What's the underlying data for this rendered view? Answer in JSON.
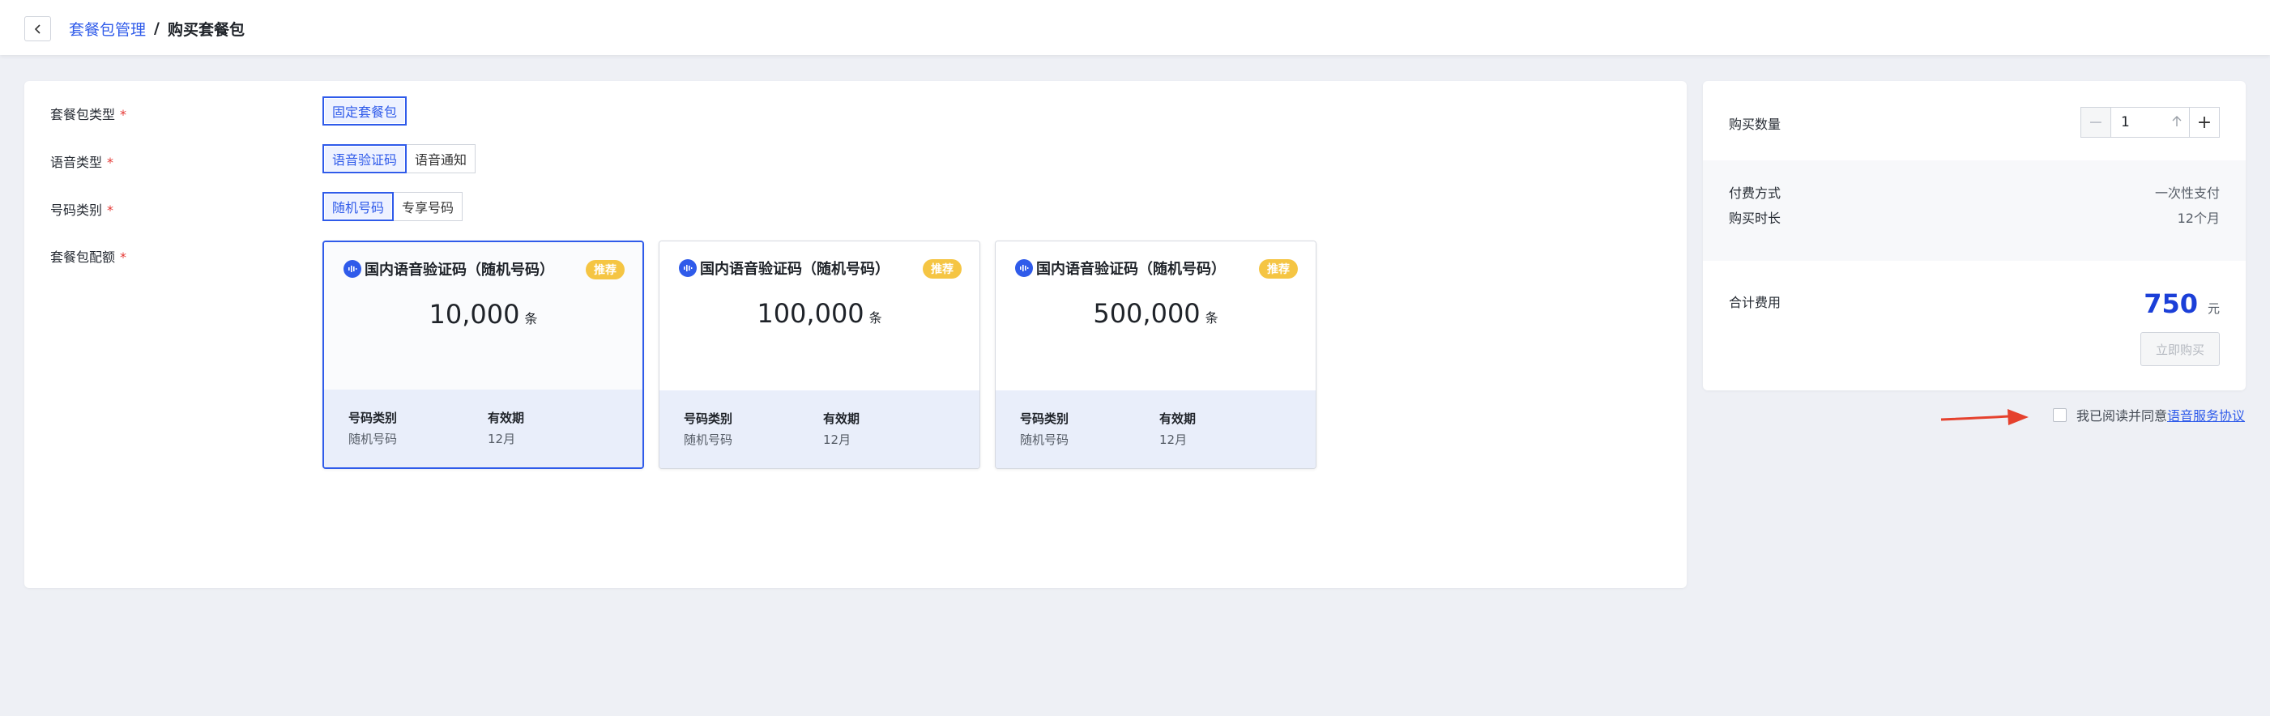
{
  "header": {
    "back_icon": "chevron-left-icon",
    "breadcrumb_parent": "套餐包管理",
    "breadcrumb_sep": "/",
    "breadcrumb_current": "购买套餐包"
  },
  "form": {
    "package_type": {
      "label": "套餐包类型",
      "required": "*",
      "options": [
        "固定套餐包"
      ],
      "selected": "固定套餐包"
    },
    "voice_type": {
      "label": "语音类型",
      "required": "*",
      "options": [
        "语音验证码",
        "语音通知"
      ],
      "selected": "语音验证码"
    },
    "number_type": {
      "label": "号码类别",
      "required": "*",
      "options": [
        "随机号码",
        "专享号码"
      ],
      "selected": "随机号码"
    },
    "quota": {
      "label": "套餐包配额",
      "required": "*"
    }
  },
  "cards": [
    {
      "title": "国内语音验证码（随机号码）",
      "badge": "推荐",
      "amount": "10,000",
      "unit": "条",
      "key1": "号码类别",
      "val1": "随机号码",
      "key2": "有效期",
      "val2": "12月",
      "selected": true
    },
    {
      "title": "国内语音验证码（随机号码）",
      "badge": "推荐",
      "amount": "100,000",
      "unit": "条",
      "key1": "号码类别",
      "val1": "随机号码",
      "key2": "有效期",
      "val2": "12月",
      "selected": false
    },
    {
      "title": "国内语音验证码（随机号码）",
      "badge": "推荐",
      "amount": "500,000",
      "unit": "条",
      "key1": "号码类别",
      "val1": "随机号码",
      "key2": "有效期",
      "val2": "12月",
      "selected": false
    }
  ],
  "side": {
    "qty_label": "购买数量",
    "qty_minus": "−",
    "qty_plus": "+",
    "qty_value": "1",
    "pay_label": "付费方式",
    "pay_value": "一次性支付",
    "duration_label": "购买时长",
    "duration_value": "12个月",
    "total_label": "合计费用",
    "total_value": "750",
    "total_unit": "元",
    "buy_label": "立即购买"
  },
  "agreement": {
    "text": "我已阅读并同意",
    "link": "语音服务协议",
    "checked": false
  },
  "colors": {
    "accent": "#2f5bea",
    "badge": "#f5c543",
    "arrow": "#e5412d",
    "total": "#1b3fd8"
  }
}
